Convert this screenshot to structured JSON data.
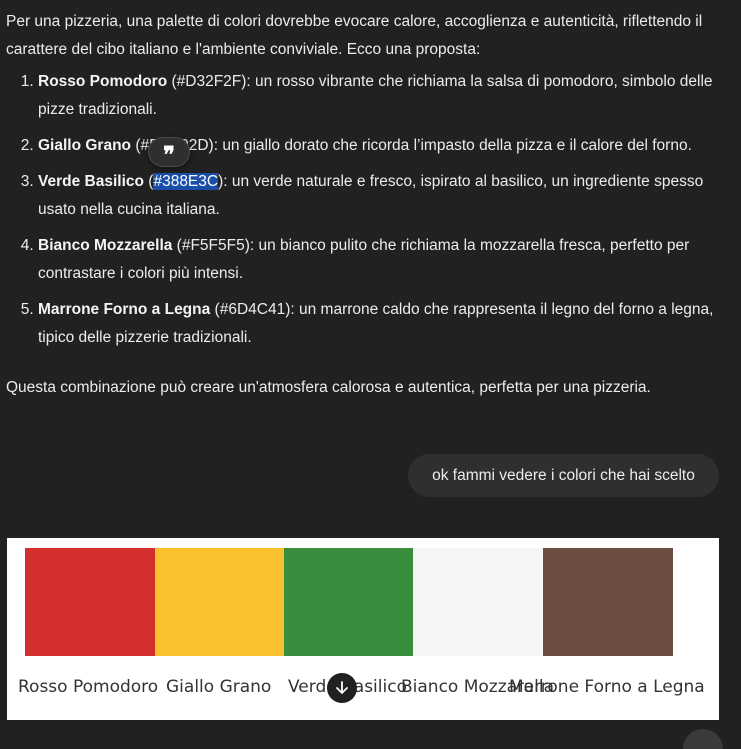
{
  "message": {
    "intro": "Per una pizzeria, una palette di colori dovrebbe evocare calore, accoglienza e autenticità, riflettendo il carattere del cibo italiano e l'ambiente conviviale. Ecco una proposta:",
    "items": [
      {
        "name": "Rosso Pomodoro",
        "hex_pre": " (#D32F2F)",
        "hex_hl": "",
        "hex_post": "",
        "desc": ": un rosso vibrante che richiama la salsa di pomodoro, simbolo delle pizze tradizionali."
      },
      {
        "name": "Giallo Grano",
        "hex_pre": " (#FBC02D)",
        "hex_hl": "",
        "hex_post": "",
        "desc": ": un giallo dorato che ricorda l’impasto della pizza e il calore del forno."
      },
      {
        "name": "Verde Basilico",
        "hex_pre": " (",
        "hex_hl": "#388E3C",
        "hex_post": ")",
        "desc": ": un verde naturale e fresco, ispirato al basilico, un ingrediente spesso usato nella cucina italiana."
      },
      {
        "name": "Bianco Mozzarella",
        "hex_pre": " (#F5F5F5)",
        "hex_hl": "",
        "hex_post": "",
        "desc": ": un bianco pulito che richiama la mozzarella fresca, perfetto per contrastare i colori più intensi."
      },
      {
        "name": "Marrone Forno a Legna",
        "hex_pre": " (#6D4C41)",
        "hex_hl": "",
        "hex_post": "",
        "desc": ": un marrone caldo che rappresenta il legno del forno a legna, tipico delle pizzerie tradizionali."
      }
    ],
    "closing": "Questa combinazione può creare un'atmosfera calorosa e autentica, perfetta per una pizzeria."
  },
  "quote_button": {
    "glyph": "❞"
  },
  "user_message": "ok fammi vedere i colori che hai scelto",
  "palette": {
    "swatches": [
      {
        "label": "Rosso Pomodoro",
        "color": "#D32F2F"
      },
      {
        "label": "Giallo Grano",
        "color": "#FBC02D"
      },
      {
        "label": "Verde Basilico",
        "color": "#388E3C"
      },
      {
        "label": "Bianco Mozzarella",
        "color": "#F5F5F5"
      },
      {
        "label": "Marrone Forno a Legna",
        "color": "#6D4C41"
      }
    ]
  },
  "scroll_button": {
    "icon": "arrow-down-icon"
  }
}
